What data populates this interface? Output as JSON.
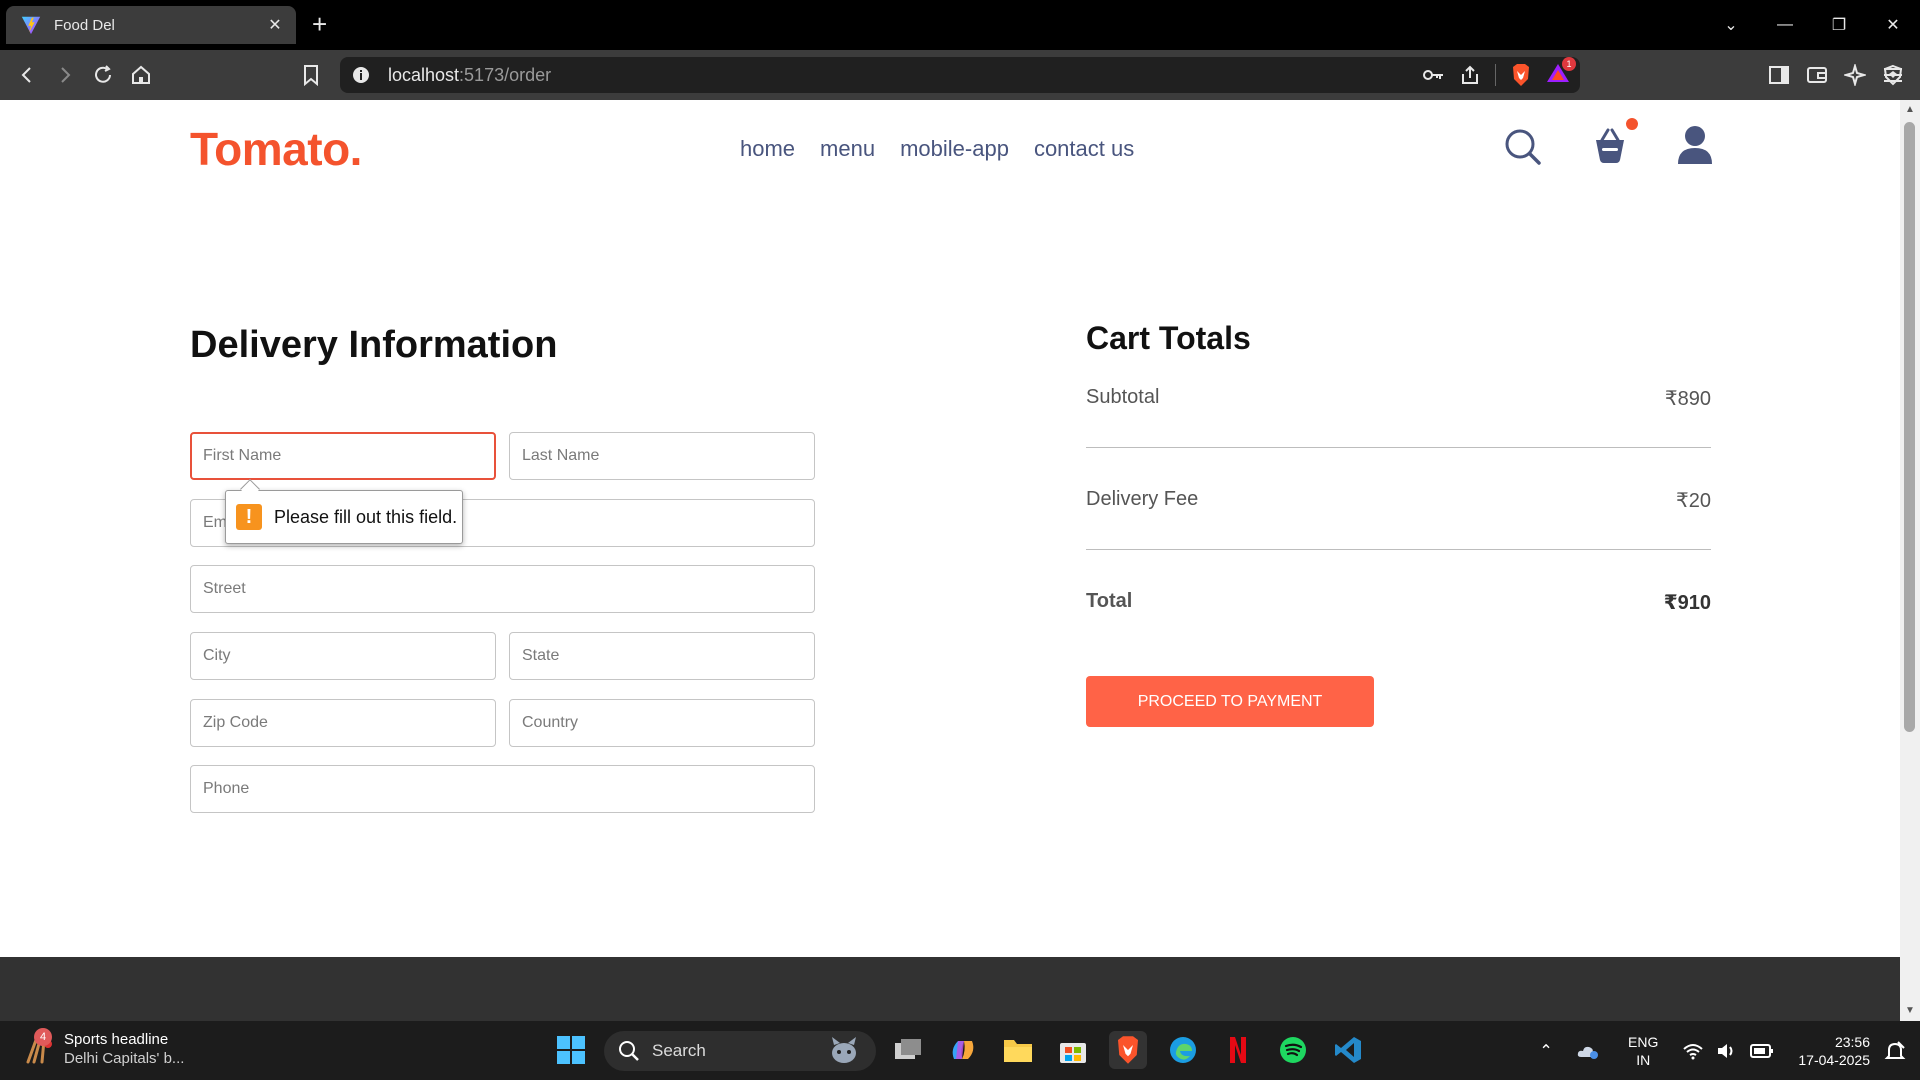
{
  "browser": {
    "tab_title": "Food Del",
    "url_host": "localhost",
    "url_path": ":5173/order",
    "bat_badge": "1"
  },
  "site": {
    "logo": "Tomato.",
    "nav": [
      "home",
      "menu",
      "mobile-app",
      "contact us"
    ],
    "accent_color": "#f4532d"
  },
  "delivery": {
    "title": "Delivery Information",
    "placeholders": {
      "first_name": "First Name",
      "last_name": "Last Name",
      "email": "Em",
      "street": "Street",
      "city": "City",
      "state": "State",
      "zip": "Zip Code",
      "country": "Country",
      "phone": "Phone"
    },
    "validation_message": "Please fill out this field."
  },
  "cart": {
    "title": "Cart Totals",
    "subtotal_label": "Subtotal",
    "subtotal_value": "₹890",
    "delivery_label": "Delivery Fee",
    "delivery_value": "₹20",
    "total_label": "Total",
    "total_value": "₹910",
    "button_label": "PROCEED TO PAYMENT"
  },
  "taskbar": {
    "news_badge": "4",
    "news_title": "Sports headline",
    "news_sub": "Delhi Capitals' b...",
    "search_label": "Search",
    "lang_line1": "ENG",
    "lang_line2": "IN",
    "time": "23:56",
    "date": "17-04-2025"
  }
}
